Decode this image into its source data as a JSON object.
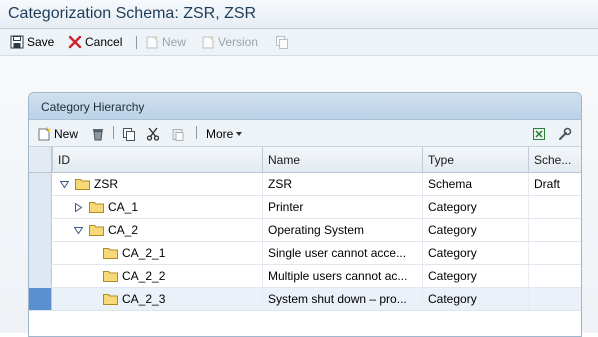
{
  "window": {
    "title": "Categorization Schema: ZSR, ZSR"
  },
  "toolbar": {
    "save": "Save",
    "cancel": "Cancel",
    "new": "New",
    "version": "Version"
  },
  "panel": {
    "title": "Category Hierarchy",
    "toolbar": {
      "new": "New",
      "more": "More"
    }
  },
  "table": {
    "columns": [
      "ID",
      "Name",
      "Type",
      "Sche..."
    ],
    "rows": [
      {
        "id": "ZSR",
        "name": "ZSR",
        "type": "Schema",
        "status": "Draft"
      },
      {
        "id": "CA_1",
        "name": "Printer",
        "type": "Category",
        "status": ""
      },
      {
        "id": "CA_2",
        "name": "Operating System",
        "type": "Category",
        "status": ""
      },
      {
        "id": "CA_2_1",
        "name": "Single user cannot acce...",
        "type": "Category",
        "status": ""
      },
      {
        "id": "CA_2_2",
        "name": "Multiple users cannot ac...",
        "type": "Category",
        "status": ""
      },
      {
        "id": "CA_2_3",
        "name": "System shut down – pro...",
        "type": "Category",
        "status": ""
      }
    ]
  },
  "icons": [
    "save-icon",
    "cancel-icon",
    "new-icon",
    "version-icon",
    "copy-icon",
    "delete-icon",
    "cut-icon",
    "paste-icon",
    "dropdown-arrow-icon",
    "export-icon",
    "settings-icon",
    "folder-icon",
    "expand-icon",
    "collapse-icon"
  ]
}
